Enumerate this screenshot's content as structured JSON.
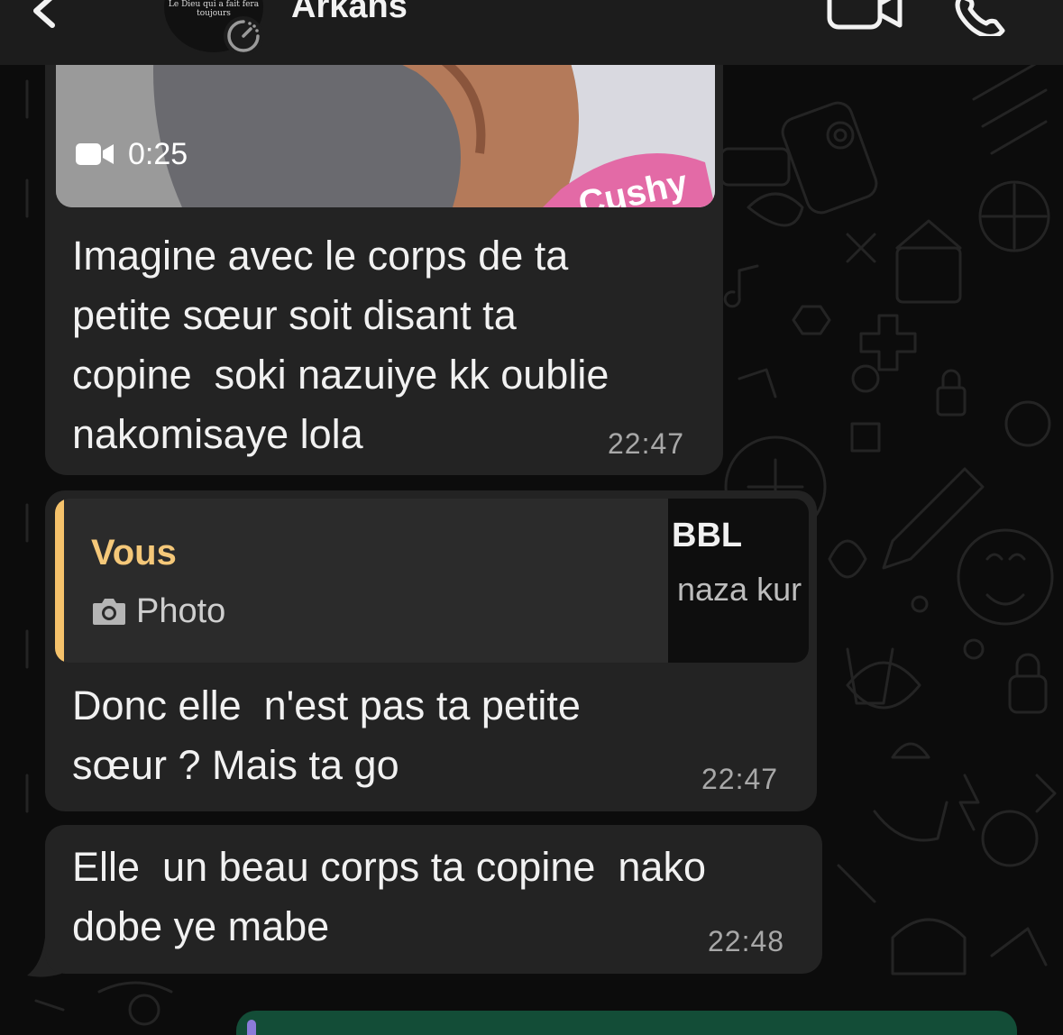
{
  "header": {
    "contact_name": "Arkans",
    "avatar_caption": "Le Dieu qui a fait\nfera toujours"
  },
  "messages": [
    {
      "type": "video",
      "duration": "0:25",
      "text": "Imagine avec le corps de ta\npetite sœur soit disant ta\ncopine  soki nazuiye kk oublie\nnakomisaye lola",
      "time": "22:47"
    },
    {
      "type": "reply",
      "quote": {
        "author": "Vous",
        "media_type": "Photo",
        "thumb_title": "BBL",
        "thumb_subtitle": "naza kur"
      },
      "text": "Donc elle  n'est pas ta petite\nsœur ? Mais ta go",
      "time": "22:47"
    },
    {
      "type": "text",
      "text": "Elle  un beau corps ta copine  nako\ndobe ye mabe",
      "time": "22:48"
    }
  ],
  "colors": {
    "header_bg": "#1c1c1c",
    "bubble_incoming": "#232323",
    "bubble_outgoing": "#134d37",
    "quote_accent": "#f5c26b",
    "timestamp": "#a8a8a8"
  },
  "icons": {
    "back": "chevron-left-icon",
    "video_call": "video-camera-icon",
    "voice_call": "phone-icon",
    "video_badge": "video-icon",
    "photo_badge": "camera-icon"
  }
}
